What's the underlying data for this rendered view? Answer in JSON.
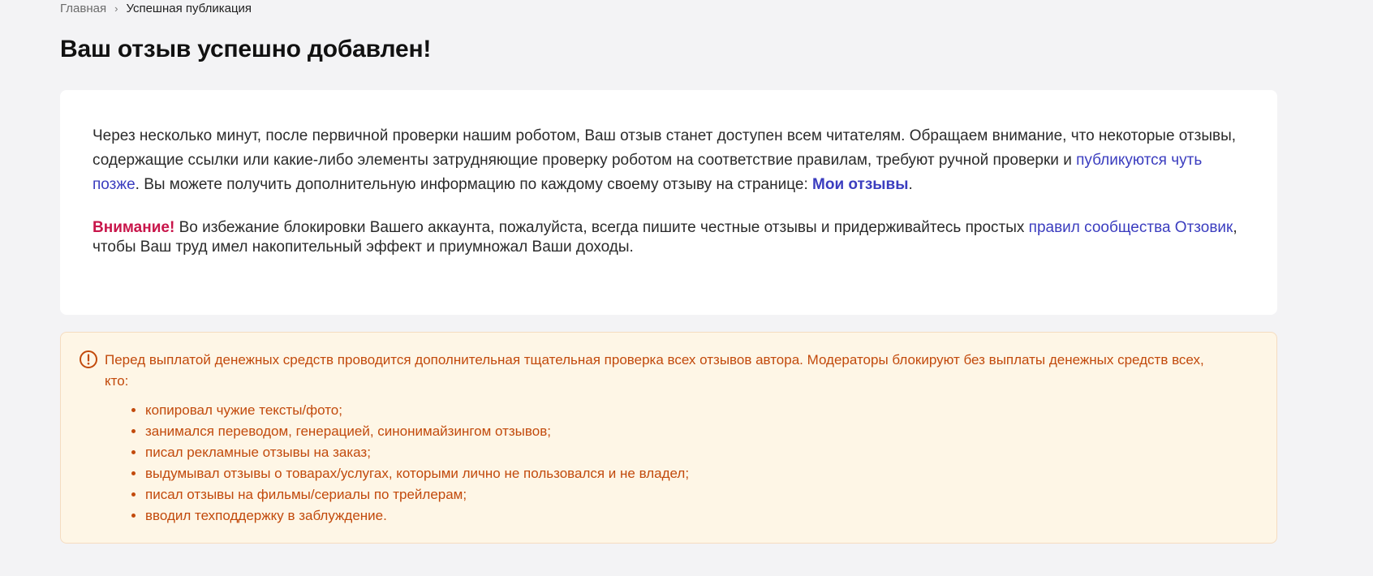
{
  "breadcrumb": {
    "home": "Главная",
    "separator": "›",
    "current": "Успешная публикация"
  },
  "page_title": "Ваш отзыв успешно добавлен!",
  "info_card": {
    "paragraph1": {
      "text_before_link": "Через несколько минут, после первичной проверки нашим роботом, Ваш отзыв станет доступен всем читателям. Обращаем внимание, что некоторые отзывы, содержащие ссылки или какие-либо элементы затрудняющие проверку роботом на соответствие правилам, требуют ручной проверки и ",
      "link_later": "публикуются чуть позже",
      "text_after_link": ". Вы можете получить дополнительную информацию по каждому своему отзыву на странице: ",
      "link_my_reviews": "Мои отзывы",
      "end": "."
    },
    "paragraph2": {
      "attention": "Внимание!",
      "text_before_link": " Во избежание блокировки Вашего аккаунта, пожалуйста, всегда пишите честные отзывы и придерживайтесь простых ",
      "link_rules": "правил сообщества Отзовик",
      "text_after_link": ", чтобы Ваш труд имел накопительный эффект и приумножал Ваши доходы."
    }
  },
  "warning_box": {
    "icon": "exclamation-circle-icon",
    "intro": "Перед выплатой денежных средств проводится дополнительная тщательная проверка всех отзывов автора. Модераторы блокируют без выплаты денежных средств всех, кто:",
    "items": [
      "копировал чужие тексты/фото;",
      "занимался переводом, генерацией, синонимайзингом отзывов;",
      "писал рекламные отзывы на заказ;",
      "выдумывал отзывы о товарах/услугах, которыми лично не пользовался и не владел;",
      "писал отзывы на фильмы/сериалы по трейлерам;",
      "вводил техподдержку в заблуждение."
    ]
  },
  "colors": {
    "background": "#f3f3f5",
    "link": "#3b3dbf",
    "attention": "#c8154a",
    "warning_text": "#c24a0c",
    "warning_bg": "#fef6e6"
  }
}
